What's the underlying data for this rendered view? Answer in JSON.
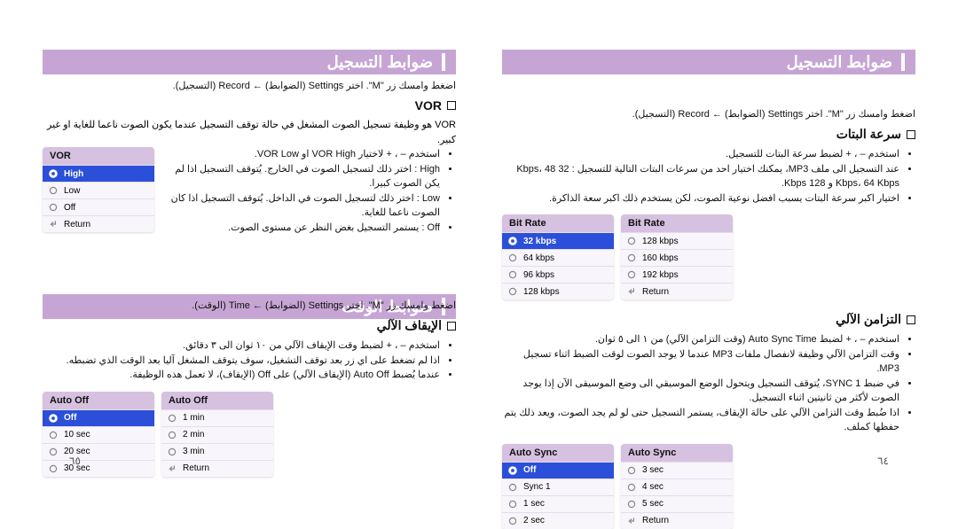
{
  "right": {
    "band_title": "ضوابط التسجيل",
    "crumb": "اضغط وامسك زر \"M\". اختر Settings (الضوابط) ← Record (التسجيل).",
    "section_bitrate": {
      "title": "سرعة البتات",
      "bullets": [
        "استخدم – ، + لضبط سرعة البتات للتسجيل.",
        "عند التسجيل الى ملف MP3، يمكنك اختيار احد من سرعات البتات التالية للتسجيل : 32 Kbps، 48 Kbps، 64 Kbps و 128 Kbps.",
        "اختيار اكبر سرعة البتات يسبب افضل نوعية الصوت، لكن يستخدم ذلك اكبر سعة الذاكرة."
      ]
    },
    "panel_bitrate": {
      "header": "Bit Rate",
      "left": [
        "32 kbps",
        "64 kbps",
        "96 kbps",
        "128 kbps"
      ],
      "right": [
        "128 kbps",
        "160 kbps",
        "192 kbps",
        "Return"
      ]
    },
    "section_sync": {
      "title": "التزامن الآلي",
      "bullets": [
        "استخدم – ، + لضبط Auto Sync Time (وقت التزامن الآلي) من ١ الى ٥ ثوان.",
        "وقت التزامن الآلي وظيفة لانفصال ملفات MP3 عندما لا يوجد الصوت لوقت الضبط اثناء تسجيل MP3.",
        "في ضبط SYNC 1، يُتوقف التسجيل ويتحول الوضع الموسيقي الى وضع الموسيقى الآن إذا يوجد الصوت لأكثر من ثانيتين اثناء التسجيل.",
        "اذا ضُبط وقت التزامن الآلي على حالة الإيقاف، يستمر التسجيل حتى لو لم يجد الصوت، ويعد ذلك يتم حفظها كملف."
      ]
    },
    "panel_sync": {
      "header": "Auto Sync",
      "left": [
        "Off",
        "Sync 1",
        "1 sec",
        "2 sec"
      ],
      "right": [
        "3 sec",
        "4 sec",
        "5 sec",
        "Return"
      ]
    },
    "pagenum": "٦٤"
  },
  "left": {
    "band1_title": "ضوابط التسجيل",
    "crumb1": "اضغط وامسك زر \"M\". اختر Settings (الضوابط) ← Record (التسجيل).",
    "section_vor": {
      "title": "VOR",
      "intro": "VOR هو وظيفة تسجيل الصوت المشغل في حالة توقف التسجيل عندما يكون الصوت ناعما للغاية او غير كبير.",
      "bullets": [
        "استخدم – ، + لاختيار VOR High او VOR Low.",
        "High : اختر ذلك لتسجيل الصوت في الخارج. يُتوقف التسجيل اذا لم يكن الصوت كبيرا.",
        "Low : اختر ذلك لتسجيل الصوت في الداخل. يُتوقف التسجيل اذا كان الصوت ناعما للغاية.",
        "Off : يستمر التسجيل بغض النظر عن مستوى الصوت."
      ]
    },
    "panel_vor": {
      "header": "VOR",
      "rows": [
        "High",
        "Low",
        "Off",
        "Return"
      ]
    },
    "band2_title": "ضوابط الوقت",
    "crumb2": "اضغط وامسك زر \"M\". اختر Settings (الضوابط) ← Time (الوقت).",
    "section_autooff": {
      "title": "الإيقاف الآلي",
      "bullets": [
        "استخدم – ، + لضبط وقت الإيقاف الآلي من ١٠ ثوان الى ٣ دقائق.",
        "اذا لم تضغط على اي زر بعد توقف التشغيل، سوف يتوقف المشغل آليا بعد الوقت الذي تضبطه.",
        "عندما يُضبط Auto Off (الإيقاف الآلي) على Off (الإيقاف)، لا تعمل هذه الوظيفة."
      ]
    },
    "panel_autooff": {
      "header": "Auto Off",
      "left": [
        "Off",
        "10 sec",
        "20 sec",
        "30 sec"
      ],
      "right": [
        "1 min",
        "2 min",
        "3 min",
        "Return"
      ]
    },
    "pagenum": "٦٥"
  },
  "icons": {
    "gear": "gear-icon",
    "dot": "dot-icon",
    "return": "return-icon"
  }
}
